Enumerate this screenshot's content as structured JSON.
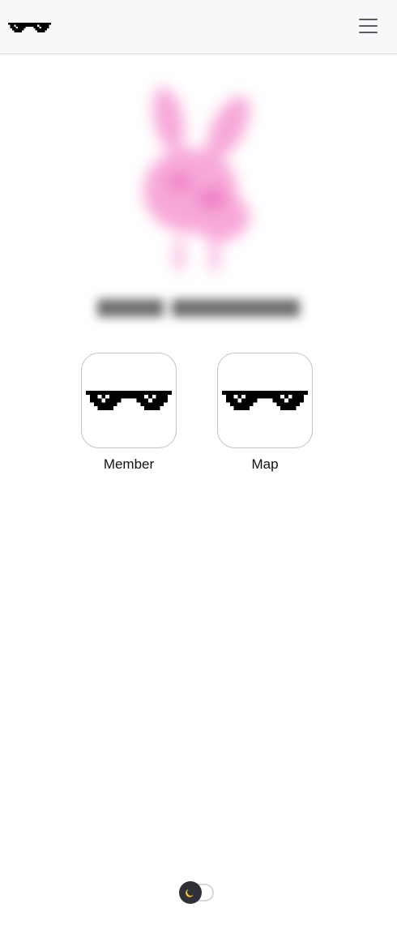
{
  "header": {
    "logo_icon": "pixel-sunglasses-icon",
    "menu_icon": "hamburger-menu-icon"
  },
  "hero": {
    "image_icon": "blurred-pink-bunny-image",
    "title_note": "blurred"
  },
  "tiles": [
    {
      "label": "Member",
      "icon": "pixel-sunglasses-icon"
    },
    {
      "label": "Map",
      "icon": "pixel-sunglasses-icon"
    }
  ],
  "theme_toggle": {
    "icon": "moon-icon",
    "state": "dark"
  },
  "colors": {
    "header_bg": "#f7f8fa",
    "tile_border": "#c3c3c3",
    "bunny_pink": "#f7a8d8",
    "toggle_knob": "#2f3137",
    "moon": "#f5c842"
  }
}
